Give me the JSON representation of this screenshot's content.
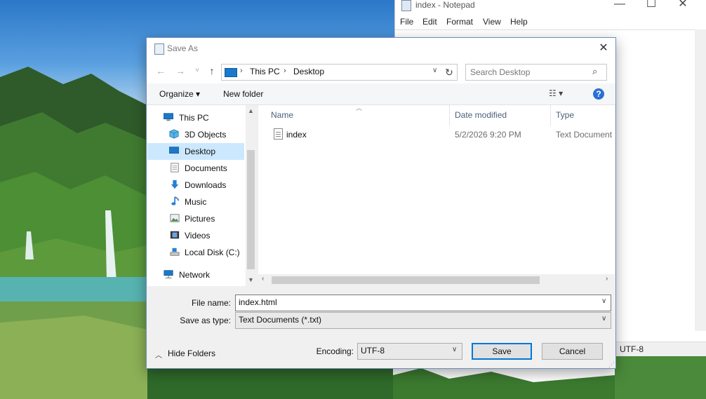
{
  "notepad": {
    "title": "index - Notepad",
    "menu": [
      "File",
      "Edit",
      "Format",
      "View",
      "Help"
    ],
    "status_encoding": "UTF-8",
    "controls": {
      "minimize": "—",
      "maximize": "☐",
      "close": "✕"
    }
  },
  "dialog": {
    "title": "Save As",
    "close": "✕",
    "nav": {
      "back": "←",
      "forward": "→",
      "recent": "˅",
      "up": "↑"
    },
    "address": {
      "crumbs": [
        "This PC",
        "Desktop"
      ],
      "separator": "›",
      "dropdown": "∨",
      "refresh": "↻"
    },
    "search": {
      "placeholder": "Search Desktop",
      "icon": "⌕"
    },
    "toolbar": {
      "organize": "Organize ▾",
      "new_folder": "New folder",
      "view": "☷ ▾",
      "help": "?"
    },
    "navpane": {
      "items": [
        {
          "label": "This PC",
          "icon": "pc-icon"
        },
        {
          "label": "3D Objects",
          "icon": "cube-icon"
        },
        {
          "label": "Desktop",
          "icon": "desktop-icon",
          "selected": true
        },
        {
          "label": "Documents",
          "icon": "document-icon"
        },
        {
          "label": "Downloads",
          "icon": "download-icon"
        },
        {
          "label": "Music",
          "icon": "music-icon"
        },
        {
          "label": "Pictures",
          "icon": "picture-icon"
        },
        {
          "label": "Videos",
          "icon": "video-icon"
        },
        {
          "label": "Local Disk (C:)",
          "icon": "disk-icon"
        },
        {
          "label": "Network",
          "icon": "network-icon"
        }
      ]
    },
    "columns": {
      "name": "Name",
      "date": "Date modified",
      "type": "Type"
    },
    "files": [
      {
        "name": "index",
        "date": "5/2/2026 9:20 PM",
        "type": "Text Document"
      }
    ],
    "form": {
      "filename_label": "File name:",
      "filename_value": "index.html",
      "savetype_label": "Save as type:",
      "savetype_value": "Text Documents (*.txt)",
      "encoding_label": "Encoding:",
      "encoding_value": "UTF-8",
      "save_button": "Save",
      "cancel_button": "Cancel",
      "hide_folders": "Hide Folders"
    }
  }
}
